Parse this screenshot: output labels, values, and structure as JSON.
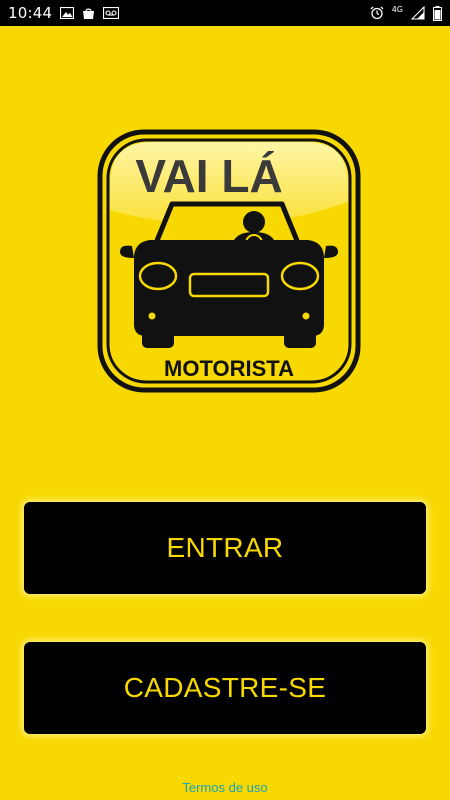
{
  "status_bar": {
    "time": "10:44",
    "left_icons": [
      "image-icon",
      "bag-icon",
      "voicemail-icon"
    ],
    "right_icons": [
      "alarm-icon",
      "network-4g-icon",
      "signal-icon",
      "battery-icon"
    ],
    "network_label": "4G"
  },
  "logo": {
    "title": "VAI LÁ",
    "subtitle": "MOTORISTA",
    "icon": "car-with-driver-icon"
  },
  "buttons": {
    "login_label": "ENTRAR",
    "signup_label": "CADASTRE-SE"
  },
  "footer": {
    "terms_label": "Termos de uso"
  },
  "colors": {
    "background": "#f7d800",
    "button_bg": "#000000",
    "button_text": "#f7d800",
    "link": "#1aa2b9"
  }
}
